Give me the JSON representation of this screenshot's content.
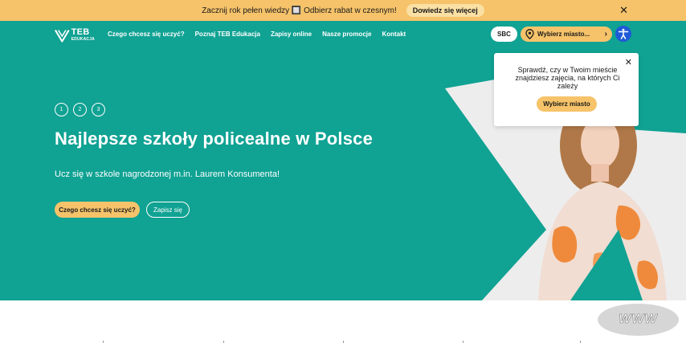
{
  "promo": {
    "text": "Zacznij rok pełen wiedzy 🔲 Odbierz rabat w czesnym!",
    "button": "Dowiedz się więcej",
    "close": "✕"
  },
  "header": {
    "logo_main": "TEB",
    "logo_sub": "EDUKACJA",
    "nav": [
      "Czego chcesz się uczyć?",
      "Poznaj TEB Edukacja",
      "Zapisy online",
      "Nasze promocje",
      "Kontakt"
    ],
    "sbc": "SBC",
    "city_button": "Wybierz miasto...",
    "city_chevron": "›"
  },
  "hero": {
    "slides": [
      "1",
      "2",
      "3"
    ],
    "title": "Najlepsze szkoły policealne w Polsce",
    "subtitle": "Ucz się w szkole nagrodzonej m.in. Laurem Konsumenta!",
    "cta_primary": "Czego chcesz się uczyć?",
    "cta_secondary": "Zapisz się"
  },
  "popup": {
    "text": "Sprawdź, czy w Twoim mieście znajdziesz zajęcia, na których Ci zależy",
    "button": "Wybierz miasto",
    "close": "✕"
  },
  "badge": {
    "text": "WWW"
  },
  "colors": {
    "teal": "#10a293",
    "yellow": "#f6c36a",
    "access_blue": "#1f5ad6"
  }
}
